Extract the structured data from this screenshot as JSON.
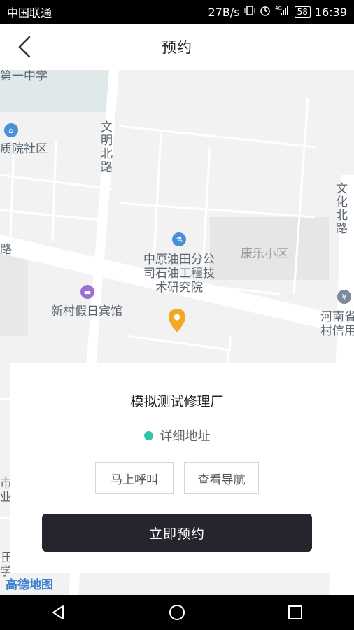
{
  "status_bar": {
    "carrier": "中国联通",
    "net_speed": "27B/s",
    "battery": "58",
    "time": "16:39",
    "icons": [
      "vibrate-icon",
      "alarm-icon",
      "signal-4g-icon",
      "battery-icon"
    ]
  },
  "header": {
    "title": "预约",
    "back_icon": "chevron-left-icon"
  },
  "map": {
    "labels": {
      "school": "第一中学",
      "community_west": "质院社区",
      "wenming_rd": "文明北路",
      "wenhua_rd": "文化北路",
      "road_left": "路",
      "kangle": "康乐小区",
      "institute": "中原油田分公司石油工程技术研究院",
      "institute_l1": "中原油田分公",
      "institute_l2": "司石油工程技",
      "institute_l3": "术研究院",
      "hotel": "新村假日宾馆",
      "bank_l1": "河南省",
      "bank_l2": "村信用",
      "left_l1": "市",
      "left_l2": "业",
      "bottom_left": "田",
      "bottom_left2": "学"
    },
    "marker_icon": "location-pin-icon",
    "logo": "高德地图"
  },
  "card": {
    "place_name": "模拟测试修理厂",
    "address": "详细地址",
    "call_label": "马上呼叫",
    "nav_label": "查看导航",
    "reserve_label": "立即预约",
    "status_color": "#2ec4a5",
    "primary_color": "#24252d"
  },
  "nav_bar": {
    "icons": [
      "back-triangle-icon",
      "home-circle-icon",
      "recents-square-icon"
    ]
  }
}
